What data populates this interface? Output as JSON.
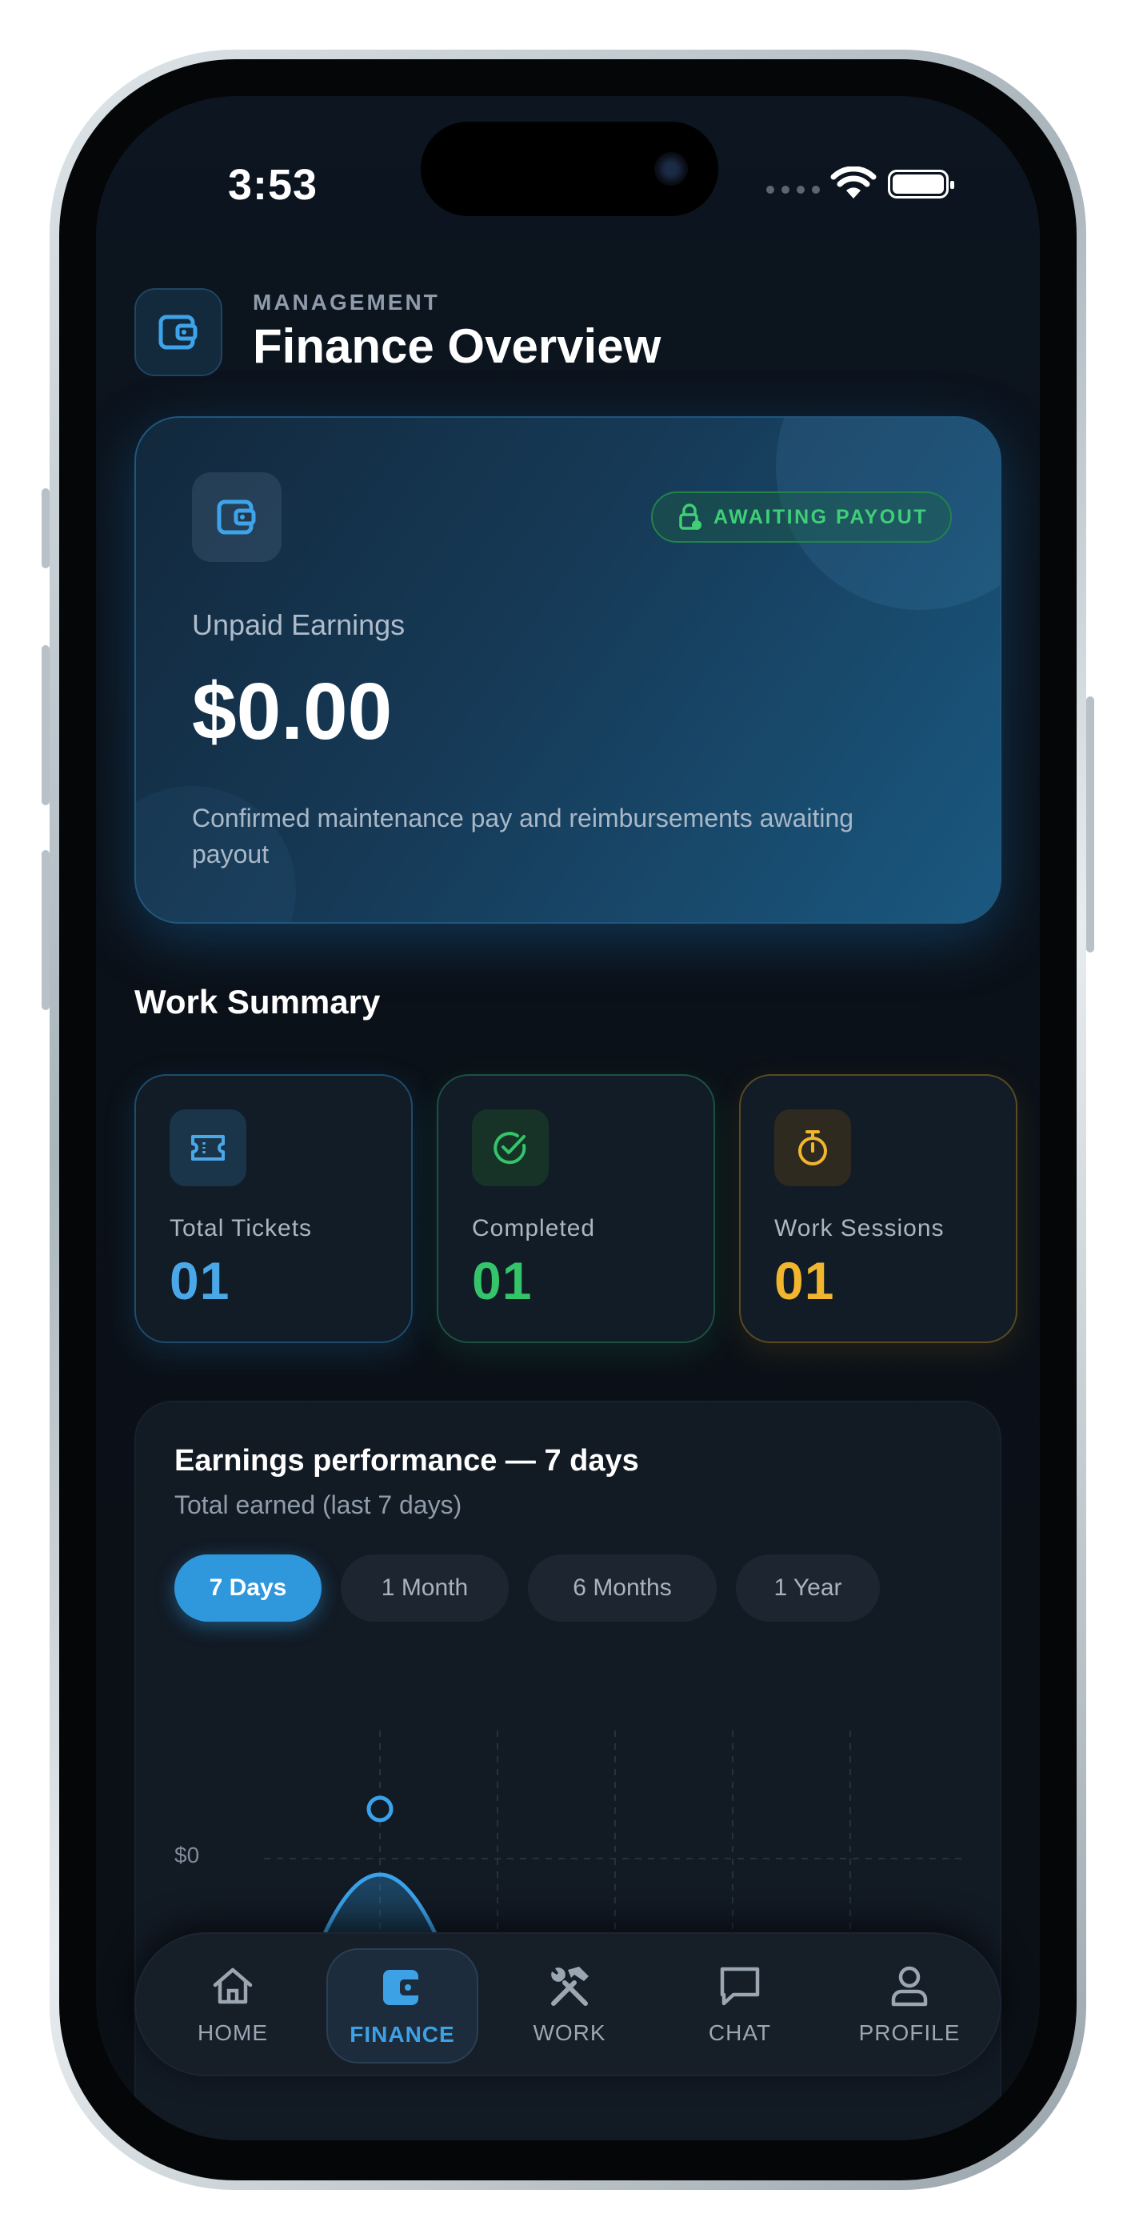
{
  "status_bar": {
    "time": "3:53"
  },
  "header": {
    "kicker": "MANAGEMENT",
    "title": "Finance Overview",
    "icon": "wallet-icon"
  },
  "earnings_card": {
    "badge_label": "AWAITING PAYOUT",
    "badge_icon": "lock-clock-icon",
    "label": "Unpaid Earnings",
    "amount": "$0.00",
    "description": "Confirmed maintenance pay and reimbursements awaiting payout"
  },
  "work_summary": {
    "title": "Work Summary",
    "cards": [
      {
        "label": "Total Tickets",
        "value": "01",
        "icon": "ticket-icon",
        "color": "#4aa8e8"
      },
      {
        "label": "Completed",
        "value": "01",
        "icon": "check-circle-icon",
        "color": "#34c46a"
      },
      {
        "label": "Work Sessions",
        "value": "01",
        "icon": "stopwatch-icon",
        "color": "#f2b62e"
      }
    ]
  },
  "performance": {
    "title": "Earnings performance — 7 days",
    "subtitle": "Total earned (last 7 days)",
    "ranges": [
      "7 Days",
      "1 Month",
      "6 Months",
      "1 Year"
    ],
    "selected_range": "7 Days",
    "y_ticks": [
      "$0",
      "$0"
    ]
  },
  "tab_bar": {
    "items": [
      {
        "label": "HOME",
        "icon": "home-icon"
      },
      {
        "label": "FINANCE",
        "icon": "wallet-icon"
      },
      {
        "label": "WORK",
        "icon": "tools-icon"
      },
      {
        "label": "CHAT",
        "icon": "chat-icon"
      },
      {
        "label": "PROFILE",
        "icon": "user-icon"
      }
    ],
    "active": "FINANCE"
  },
  "colors": {
    "accent": "#2f97dc",
    "success": "#34c46a",
    "warning": "#f2b62e",
    "background": "#0b1119"
  }
}
